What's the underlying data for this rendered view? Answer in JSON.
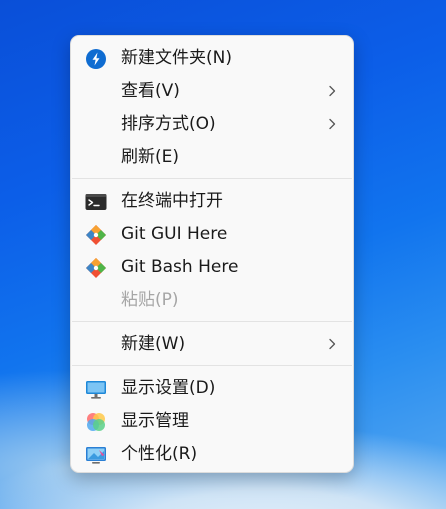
{
  "context_menu": {
    "groups": [
      [
        {
          "label": "新建文件夹(N)",
          "icon": "new-folder-icon"
        },
        {
          "label": "查看(V)",
          "submenu": true
        },
        {
          "label": "排序方式(O)",
          "submenu": true
        },
        {
          "label": "刷新(E)"
        }
      ],
      [
        {
          "label": "在终端中打开",
          "icon": "terminal-icon"
        },
        {
          "label": "Git GUI Here",
          "icon": "git-icon"
        },
        {
          "label": "Git Bash Here",
          "icon": "git-icon"
        },
        {
          "label": "粘贴(P)",
          "disabled": true
        }
      ],
      [
        {
          "label": "新建(W)",
          "submenu": true
        }
      ],
      [
        {
          "label": "显示设置(D)",
          "icon": "monitor-icon"
        },
        {
          "label": "显示管理",
          "icon": "color-rings-icon"
        },
        {
          "label": "个性化(R)",
          "icon": "personalize-icon"
        }
      ]
    ]
  },
  "colors": {
    "menu_background": "#f9f9f9",
    "text": "#1a1a1a",
    "disabled_text": "#a6a6a6",
    "accent_blue": "#0f6cd1",
    "git_orange": "#f05033"
  }
}
